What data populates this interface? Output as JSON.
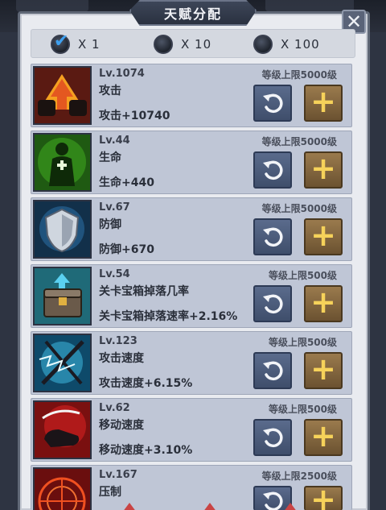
{
  "title": "天赋分配",
  "multipliers": [
    {
      "label": "X 1",
      "selected": true
    },
    {
      "label": "X 10",
      "selected": false
    },
    {
      "label": "X 100",
      "selected": false
    }
  ],
  "talents": [
    {
      "level": "Lv.1074",
      "name": "攻击",
      "bonus": "攻击+10740",
      "cap": "等级上限5000级",
      "icon": "attack-up-icon"
    },
    {
      "level": "Lv.44",
      "name": "生命",
      "bonus": "生命+440",
      "cap": "等级上限5000级",
      "icon": "health-icon"
    },
    {
      "level": "Lv.67",
      "name": "防御",
      "bonus": "防御+670",
      "cap": "等级上限5000级",
      "icon": "shield-icon"
    },
    {
      "level": "Lv.54",
      "name": "关卡宝箱掉落几率",
      "bonus": "关卡宝箱掉落速率+2.16%",
      "cap": "等级上限500级",
      "icon": "treasure-chest-icon"
    },
    {
      "level": "Lv.123",
      "name": "攻击速度",
      "bonus": "攻击速度+6.15%",
      "cap": "等级上限500级",
      "icon": "lightning-blade-icon"
    },
    {
      "level": "Lv.62",
      "name": "移动速度",
      "bonus": "移动速度+3.10%",
      "cap": "等级上限500级",
      "icon": "boot-speed-icon"
    },
    {
      "level": "Lv.167",
      "name": "压制",
      "bonus": "",
      "cap": "等级上限2500级",
      "icon": "suppress-rune-icon"
    }
  ],
  "colors": {
    "panel": "#e9ebf0",
    "row": "#bfc6d6",
    "reset_button": "#4a5a7a",
    "add_button": "#8a6a40",
    "add_plus": "#f6d25a",
    "check": "#3ea0f0"
  }
}
